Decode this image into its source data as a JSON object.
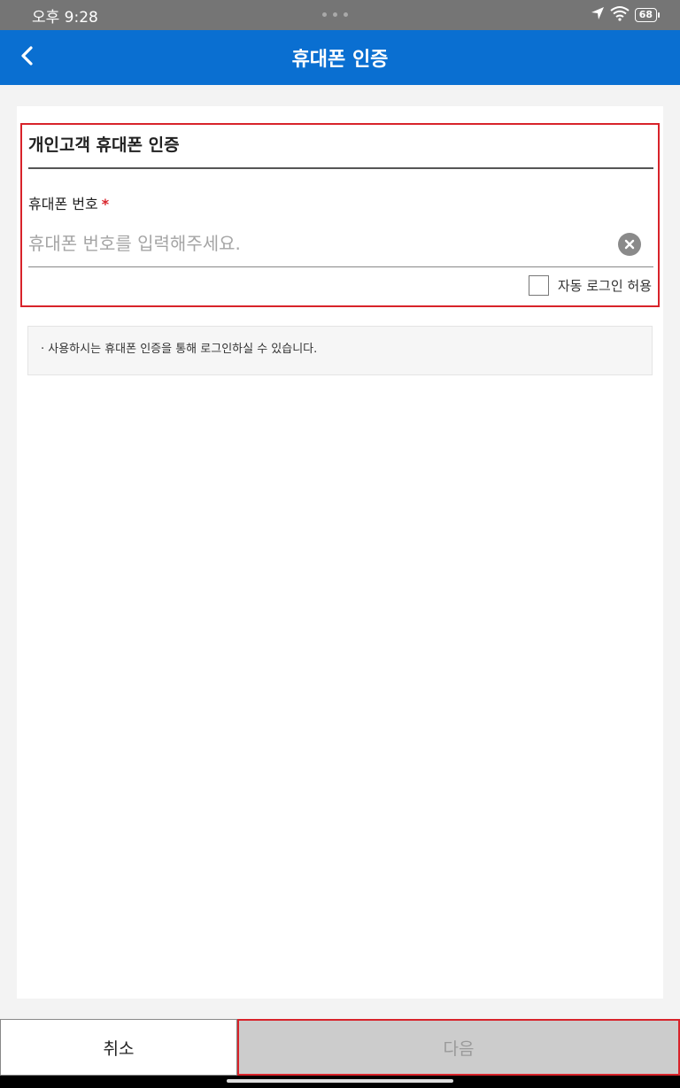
{
  "status_bar": {
    "time": "오후 9:28",
    "battery": "68",
    "icons": [
      "location-icon",
      "wifi-icon",
      "battery-icon"
    ]
  },
  "header": {
    "title": "휴대폰 인증",
    "back_icon": "chevron-left-icon",
    "background": "#0a6fd1"
  },
  "form": {
    "section_title": "개인고객 휴대폰 인증",
    "phone_label": "휴대폰 번호",
    "required_mark": "*",
    "phone_value": "",
    "phone_placeholder": "휴대폰 번호를 입력해주세요.",
    "clear_icon": "clear-circle-icon",
    "auto_login_label": "자동 로그인 허용",
    "auto_login_checked": false
  },
  "notice": {
    "text": "· 사용하시는 휴대폰 인증을 통해 로그인하실 수 있습니다."
  },
  "buttons": {
    "cancel": "취소",
    "next": "다음"
  },
  "colors": {
    "accent": "#0a6fd1",
    "highlight": "#d8232a",
    "disabled": "#cccccc"
  }
}
